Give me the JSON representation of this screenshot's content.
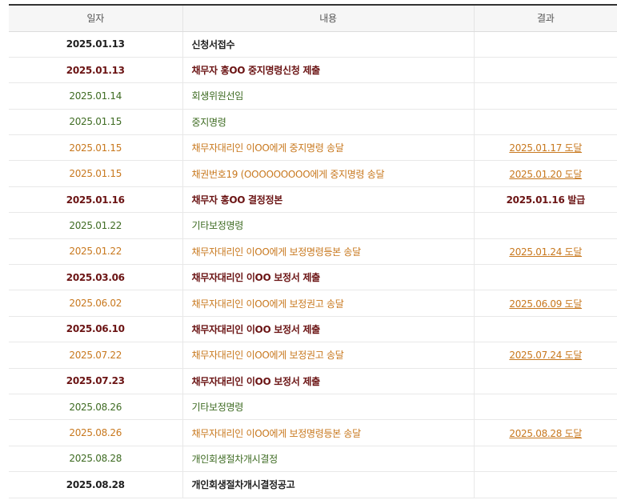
{
  "headers": {
    "date": "일자",
    "content": "내용",
    "result": "결과"
  },
  "rows": [
    {
      "date": "2025.01.13",
      "content": "신청서접수",
      "result": "",
      "style": "black",
      "result_link": false
    },
    {
      "date": "2025.01.13",
      "content": "채무자 홍OO 중지명령신청 제출",
      "result": "",
      "style": "maroon",
      "result_link": false
    },
    {
      "date": "2025.01.14",
      "content": "회생위원선임",
      "result": "",
      "style": "green",
      "result_link": false
    },
    {
      "date": "2025.01.15",
      "content": "중지명령",
      "result": "",
      "style": "green",
      "result_link": false
    },
    {
      "date": "2025.01.15",
      "content": "채무자대리인 이OO에게 중지명령 송달",
      "result": "2025.01.17 도달",
      "style": "orange",
      "result_link": true
    },
    {
      "date": "2025.01.15",
      "content": "채권번호19 (OOOOOOOOO에게 중지명령 송달",
      "result": "2025.01.20 도달",
      "style": "orange",
      "result_link": true
    },
    {
      "date": "2025.01.16",
      "content": "채무자 홍OO 결정정본",
      "result": "2025.01.16 발급",
      "style": "maroon",
      "result_link": false
    },
    {
      "date": "2025.01.22",
      "content": "기타보정명령",
      "result": "",
      "style": "green",
      "result_link": false
    },
    {
      "date": "2025.01.22",
      "content": "채무자대리인 이OO에게 보정명령등본 송달",
      "result": "2025.01.24 도달",
      "style": "orange",
      "result_link": true
    },
    {
      "date": "2025.03.06",
      "content": "채무자대리인 이OO 보정서 제출",
      "result": "",
      "style": "maroon",
      "result_link": false
    },
    {
      "date": "2025.06.02",
      "content": "채무자대리인 이OO에게 보정권고 송달",
      "result": "2025.06.09 도달",
      "style": "orange",
      "result_link": true
    },
    {
      "date": "2025.06.10",
      "content": "채무자대리인 이OO 보정서 제출",
      "result": "",
      "style": "maroon",
      "result_link": false
    },
    {
      "date": "2025.07.22",
      "content": "채무자대리인 이OO에게 보정권고 송달",
      "result": "2025.07.24 도달",
      "style": "orange",
      "result_link": true
    },
    {
      "date": "2025.07.23",
      "content": "채무자대리인 이OO 보정서 제출",
      "result": "",
      "style": "maroon",
      "result_link": false
    },
    {
      "date": "2025.08.26",
      "content": "기타보정명령",
      "result": "",
      "style": "green",
      "result_link": false
    },
    {
      "date": "2025.08.26",
      "content": "채무자대리인 이OO에게 보정명령등본 송달",
      "result": "2025.08.28 도달",
      "style": "orange",
      "result_link": true
    },
    {
      "date": "2025.08.28",
      "content": "개인회생절차개시결정",
      "result": "",
      "style": "green",
      "result_link": false
    },
    {
      "date": "2025.08.28",
      "content": "개인회생절차개시결정공고",
      "result": "",
      "style": "black",
      "result_link": false
    }
  ],
  "colors": {
    "black": "#1f1f1f",
    "maroon": "#6b1414",
    "green": "#3e6b22",
    "orange": "#c8781e",
    "header_border": "#333333"
  }
}
